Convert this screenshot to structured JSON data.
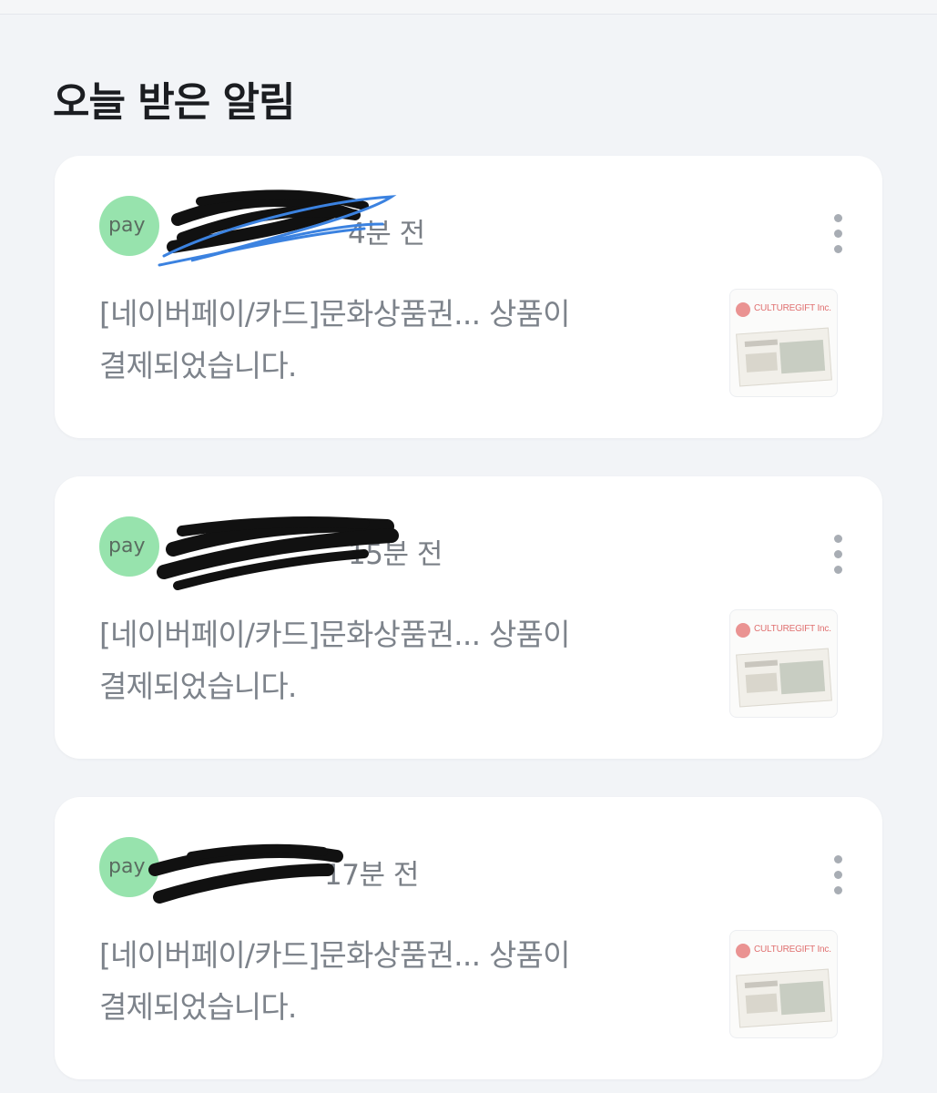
{
  "section": {
    "title": "오늘 받은 알림"
  },
  "notifications": [
    {
      "avatar_text": "pay",
      "time": "4분 전",
      "message": "[네이버페이/카드]문화상품권... 상품이 결제되었습니다.",
      "thumbnail_brand": "CULTUREGIFT Inc."
    },
    {
      "avatar_text": "pay",
      "time": "15분 전",
      "message": "[네이버페이/카드]문화상품권... 상품이 결제되었습니다.",
      "thumbnail_brand": "CULTUREGIFT Inc."
    },
    {
      "avatar_text": "pay",
      "time": "17분 전",
      "message": "[네이버페이/카드]문화상품권... 상품이 결제되었습니다.",
      "thumbnail_brand": "CULTUREGIFT Inc."
    }
  ],
  "colors": {
    "background": "#f2f4f7",
    "card": "#ffffff",
    "avatar": "#97e3ad",
    "text_muted": "#7d838b",
    "title": "#1b1d21",
    "redaction": "#111111",
    "redaction_blue": "#3b82e0"
  },
  "icons": {
    "more": "more-vertical-icon"
  }
}
